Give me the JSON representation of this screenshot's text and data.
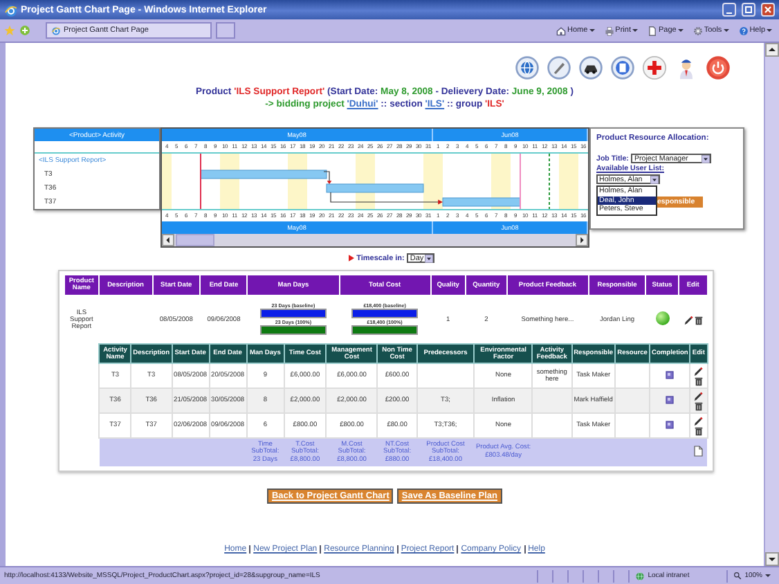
{
  "window": {
    "title": "Project Gantt Chart Page - Windows Internet Explorer"
  },
  "browser_tab": {
    "label": "Project Gantt Chart Page"
  },
  "command_bar": [
    {
      "label": "Home"
    },
    {
      "label": "Print"
    },
    {
      "label": "Page"
    },
    {
      "label": "Tools"
    },
    {
      "label": "Help"
    }
  ],
  "heading": {
    "line_1": [
      {
        "kind": "label",
        "text": "Product"
      },
      {
        "kind": "name",
        "text": "'ILS Support Report'"
      },
      {
        "kind": "label",
        "text": "(Start Date:"
      },
      {
        "kind": "date",
        "text": "May 8, 2008"
      },
      {
        "kind": "label",
        "text": "- Delievery Date:"
      },
      {
        "kind": "date",
        "text": "June 9, 2008"
      },
      {
        "kind": "label",
        "text": ")"
      }
    ],
    "line_2": [
      {
        "kind": "accent",
        "text": "-> bidding project"
      },
      {
        "kind": "link",
        "text": "'Duhui'"
      },
      {
        "kind": "label",
        "text": ":: section"
      },
      {
        "kind": "link",
        "text": "'ILS'"
      },
      {
        "kind": "label",
        "text": ":: group"
      },
      {
        "kind": "name",
        "text": "'ILS'"
      }
    ]
  },
  "gantt": {
    "header": "<Product> Activity",
    "activities": [
      {
        "kind": "product",
        "label": "<ILS Support Report>"
      },
      {
        "kind": "task",
        "label": "T3"
      },
      {
        "kind": "task",
        "label": "T36"
      },
      {
        "kind": "task",
        "label": "T37"
      }
    ],
    "top_scale": [
      {
        "month": "May08",
        "days": [
          "4",
          "5",
          "6",
          "7",
          "8",
          "9",
          "10",
          "11",
          "12",
          "13",
          "14",
          "15",
          "16",
          "17",
          "18",
          "19",
          "20",
          "21",
          "22",
          "23",
          "24",
          "25",
          "26",
          "27",
          "28",
          "29",
          "30",
          "31"
        ]
      },
      {
        "month": "Jun08",
        "days": [
          "1",
          "2",
          "3",
          "4",
          "5",
          "6",
          "7",
          "8",
          "9",
          "10",
          "11",
          "12",
          "13",
          "14",
          "15",
          "16"
        ]
      }
    ],
    "bottom_scale": [
      {
        "month": "May08",
        "days": [
          "4",
          "5",
          "6",
          "7",
          "8",
          "9",
          "10",
          "11",
          "12",
          "13",
          "14",
          "15",
          "16",
          "17",
          "18",
          "19",
          "20",
          "21",
          "22",
          "23",
          "24",
          "25",
          "26",
          "27",
          "28",
          "29",
          "30",
          "31"
        ]
      },
      {
        "month": "Jun08",
        "days": [
          "1",
          "2",
          "3",
          "4",
          "5",
          "6",
          "7",
          "8",
          "9",
          "10",
          "11",
          "12",
          "13",
          "14",
          "15",
          "16"
        ]
      }
    ]
  },
  "resource_panel": {
    "title": "Product Resource Allocation:",
    "job_title_label": "Job Title:",
    "job_title": "Project Manager",
    "user_list_label": "Available User List:",
    "user": "Holmes, Alan",
    "options": [
      {
        "label": "Holmes, Alan",
        "selected": false
      },
      {
        "label": "Deal, John",
        "selected": true
      },
      {
        "label": "Peters, Steve",
        "selected": false
      }
    ],
    "button": "esponsible"
  },
  "timescale": {
    "label": "Timescale in:",
    "value": "Day"
  },
  "product_table": {
    "columns": [
      "Product Name",
      "Description",
      "Start Date",
      "End Date",
      "Man Days",
      "Total Cost",
      "Quality",
      "Quantity",
      "Product Feedback",
      "Responsible",
      "Status",
      "Edit"
    ],
    "rows": [
      {
        "product_name": "ILS Support Report",
        "start_date": "08/05/2008",
        "end_date": "09/06/2008",
        "man_days": [
          {
            "label": "23 Days (baseline)",
            "level": 1,
            "color": "#0a1ee8"
          },
          {
            "label": "23 Days (100%)",
            "level": 1,
            "color": "#0f7a12"
          }
        ],
        "total_cost": [
          {
            "label": "£18,400 (baseline)",
            "level": 1,
            "color": "#0a1ee8"
          },
          {
            "label": "£18,400 (100%)",
            "level": 1,
            "color": "#0f7a12"
          }
        ],
        "quality": "1",
        "quantity": "2",
        "feedback": "Something here...",
        "responsible": "Jordan Ling"
      }
    ]
  },
  "activity_table": {
    "columns": [
      "Activity Name",
      "Description",
      "Start Date",
      "End Date",
      "Man Days",
      "Time Cost",
      "Management Cost",
      "Non Time Cost",
      "Predecessors",
      "Environmental Factor",
      "Activity Feedback",
      "Responsible",
      "Resource",
      "Completion",
      "Edit"
    ],
    "rows": [
      {
        "activity_name": "T3",
        "description": "T3",
        "start_date": "08/05/2008",
        "end_date": "20/05/2008",
        "man_days": "9",
        "time_cost": "£6,000.00",
        "management_cost": "£6,000.00",
        "non_time_cost": "£600.00",
        "environmental_factor": "None",
        "feedback": "something here",
        "responsible": "Task Maker"
      },
      {
        "activity_name": "T36",
        "description": "T36",
        "start_date": "21/05/2008",
        "end_date": "30/05/2008",
        "man_days": "8",
        "time_cost": "£2,000.00",
        "management_cost": "£2,000.00",
        "non_time_cost": "£200.00",
        "predecessors": "T3;",
        "environmental_factor": "Inflation",
        "responsible": "Mark Haffield"
      },
      {
        "activity_name": "T37",
        "description": "T37",
        "start_date": "02/06/2008",
        "end_date": "09/06/2008",
        "man_days": "6",
        "time_cost": "£800.00",
        "management_cost": "£800.00",
        "non_time_cost": "£80.00",
        "predecessors": "T3;T36;",
        "environmental_factor": "None",
        "responsible": "Task Maker"
      }
    ],
    "totals": {
      "man_days": "Time SubTotal: 23 Days",
      "time_cost": "T.Cost SubTotal: £8,800.00",
      "management_cost": "M.Cost SubTotal: £8,800.00",
      "non_time_cost": "NT.Cost SubTotal: £880.00",
      "predecessors": "Product Cost SubTotal: £18,400.00",
      "environmental_factor": "Product Avg. Cost: £803.48/day"
    }
  },
  "buttons": [
    "Back to Project Gantt Chart",
    "Save As Baseline Plan"
  ],
  "footer_links": [
    "Home",
    "New Project Plan",
    "Resource Planning",
    "Project Report",
    "Company Policy",
    "Help"
  ],
  "status_bar": {
    "url": "http://localhost:4133/Website_MSSQL/Project_ProductChart.aspx?project_id=28&supgroup_name=ILS",
    "zone": "Local intranet",
    "zoom": "100%"
  }
}
